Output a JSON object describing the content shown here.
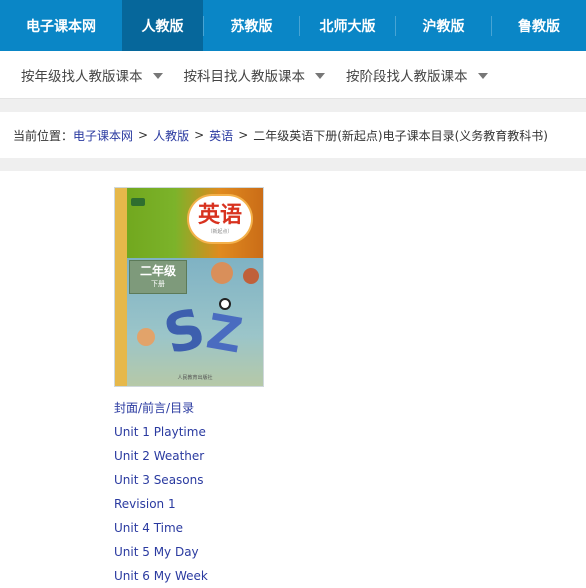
{
  "topnav": {
    "items": [
      {
        "label": "电子课本网",
        "active": false
      },
      {
        "label": "人教版",
        "active": true
      },
      {
        "label": "苏教版",
        "active": false
      },
      {
        "label": "北师大版",
        "active": false
      },
      {
        "label": "沪教版",
        "active": false
      },
      {
        "label": "鲁教版",
        "active": false
      }
    ]
  },
  "subnav": {
    "items": [
      {
        "label": "按年级找人教版课本"
      },
      {
        "label": "按科目找人教版课本"
      },
      {
        "label": "按阶段找人教版课本"
      }
    ]
  },
  "breadcrumb": {
    "prefix": "当前位置：",
    "crumbs": [
      "电子课本网",
      "人教版",
      "英语"
    ],
    "separator": ">",
    "current": "二年级英语下册(新起点)电子课本目录(义务教育教科书)"
  },
  "book": {
    "cover": {
      "title": "英语",
      "subtitle": "（新起点）",
      "grade": "二年级",
      "volume": "下册",
      "publisher": "人民教育出版社"
    }
  },
  "toc": {
    "items": [
      "封面/前言/目录",
      "Unit 1 Playtime",
      "Unit 2 Weather",
      "Unit 3 Seasons",
      "Revision 1",
      "Unit 4 Time",
      "Unit 5 My Day",
      "Unit 6 My Week"
    ]
  },
  "colors": {
    "nav_bg": "#0a86c6",
    "nav_active": "#06679b",
    "link": "#2a3aa0"
  }
}
